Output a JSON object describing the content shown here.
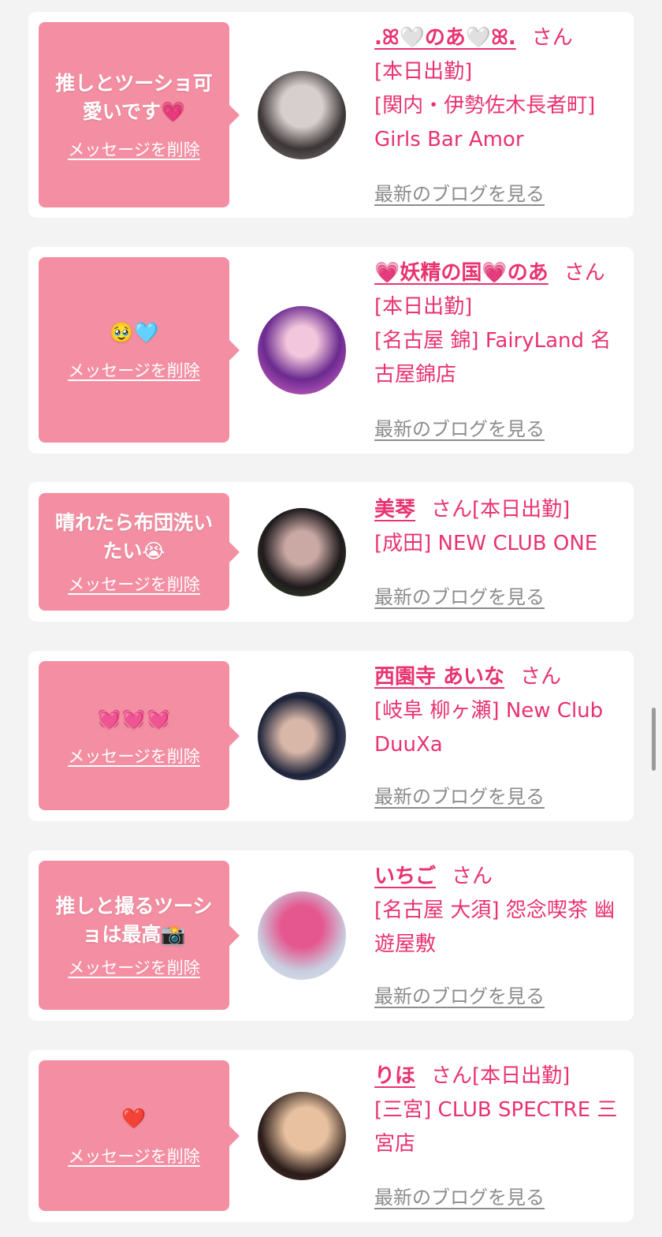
{
  "messages": [
    {
      "bubble_text": "推しとツーショ可愛いです💗",
      "delete_label": "メッセージを削除",
      "name": ".ꕤ🤍のあ🤍ꕤ.",
      "san": "さん",
      "status": "[本日出勤]",
      "shop": "[関内・伊勢佐木長者町] Girls Bar Amor",
      "blog_label": "最新のブログを見る",
      "avatar_colors": [
        "#3b3536",
        "#d7cfcd"
      ]
    },
    {
      "bubble_text": "🥹🩵",
      "delete_label": "メッセージを削除",
      "name": "💗妖精の国💗のあ",
      "san": "さん",
      "status": "[本日出勤]",
      "shop": "[名古屋 錦] FairyLand 名古屋錦店",
      "blog_label": "最新のブログを見る",
      "avatar_colors": [
        "#6b2a8f",
        "#e86fd1"
      ]
    },
    {
      "bubble_text": "晴れたら布団洗いたい😭",
      "delete_label": "メッセージを削除",
      "name": "美琴",
      "san": "さん",
      "status": "[本日出勤]",
      "shop": "[成田] NEW CLUB ONE",
      "blog_label": "最新のブログを見る",
      "avatar_colors": [
        "#1f1a1c",
        "#caa9a5"
      ]
    },
    {
      "bubble_text": "💓💓💓",
      "delete_label": "メッセージを削除",
      "name": "西園寺 あいな",
      "san": "さん",
      "status": "",
      "shop": "[岐阜 柳ヶ瀬] New Club DuuXa",
      "blog_label": "最新のブログを見る",
      "avatar_colors": [
        "#1c2238",
        "#7c7b93"
      ]
    },
    {
      "bubble_text": "推しと撮るツーショは最高📸",
      "delete_label": "メッセージを削除",
      "name": "いちご",
      "san": "さん",
      "status": "",
      "shop": "[名古屋 大須] 怨念喫茶 幽遊屋敷",
      "blog_label": "最新のブログを見る",
      "avatar_colors": [
        "#e5578f",
        "#c8cfe0"
      ]
    },
    {
      "bubble_text": "❤️",
      "delete_label": "メッセージを削除",
      "name": "りほ",
      "san": "さん",
      "status": "[本日出勤]",
      "shop": "[三宮] CLUB SPECTRE 三宮店",
      "blog_label": "最新のブログを見る",
      "avatar_colors": [
        "#2a1c1a",
        "#e8c2a0"
      ]
    }
  ],
  "colors": {
    "accent": "#e8336f",
    "bubble": "#f48fa3",
    "muted": "#8c8c8c",
    "background": "#f3f3f4"
  }
}
